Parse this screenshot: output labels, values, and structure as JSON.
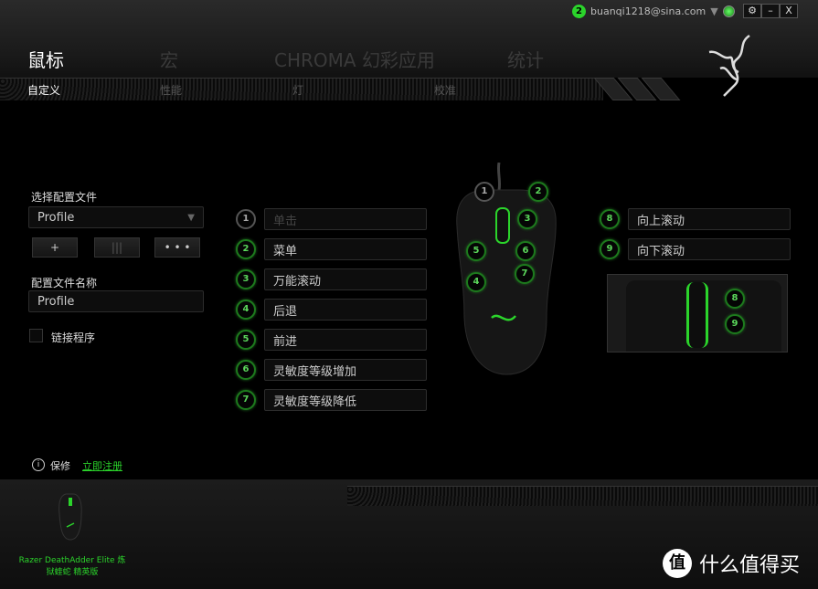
{
  "header": {
    "user_badge": "2",
    "user_email": "buanqi1218@sina.com",
    "settings_icon": "gear-icon",
    "minimize": "–",
    "close": "X",
    "main_tabs": [
      {
        "label": "鼠标",
        "active": true
      },
      {
        "label": "宏"
      },
      {
        "label": "CHROMA 幻彩应用"
      },
      {
        "label": "统计"
      }
    ],
    "sub_tabs": [
      {
        "label": "自定义",
        "active": true
      },
      {
        "label": "性能"
      },
      {
        "label": "灯"
      },
      {
        "label": "校准"
      }
    ]
  },
  "profile": {
    "select_label": "选择配置文件",
    "selected": "Profile",
    "add": "+",
    "delete": "|||",
    "more": "• • •",
    "name_label": "配置文件名称",
    "name_value": "Profile",
    "link_label": "链接程序",
    "link_checked": false
  },
  "buttons": [
    {
      "num": "1",
      "action": "单击",
      "disabled": true
    },
    {
      "num": "2",
      "action": "菜单"
    },
    {
      "num": "3",
      "action": "万能滚动"
    },
    {
      "num": "4",
      "action": "后退"
    },
    {
      "num": "5",
      "action": "前进"
    },
    {
      "num": "6",
      "action": "灵敏度等级增加"
    },
    {
      "num": "7",
      "action": "灵敏度等级降低"
    },
    {
      "num": "8",
      "action": "向上滚动"
    },
    {
      "num": "9",
      "action": "向下滚动"
    }
  ],
  "footer": {
    "warranty": "保修",
    "register": "立即注册",
    "device_name": "Razer DeathAdder Elite 炼狱蝰蛇 精英版",
    "watermark": "什么值得买",
    "watermark_icon": "值"
  },
  "colors": {
    "accent": "#2bd42b"
  }
}
